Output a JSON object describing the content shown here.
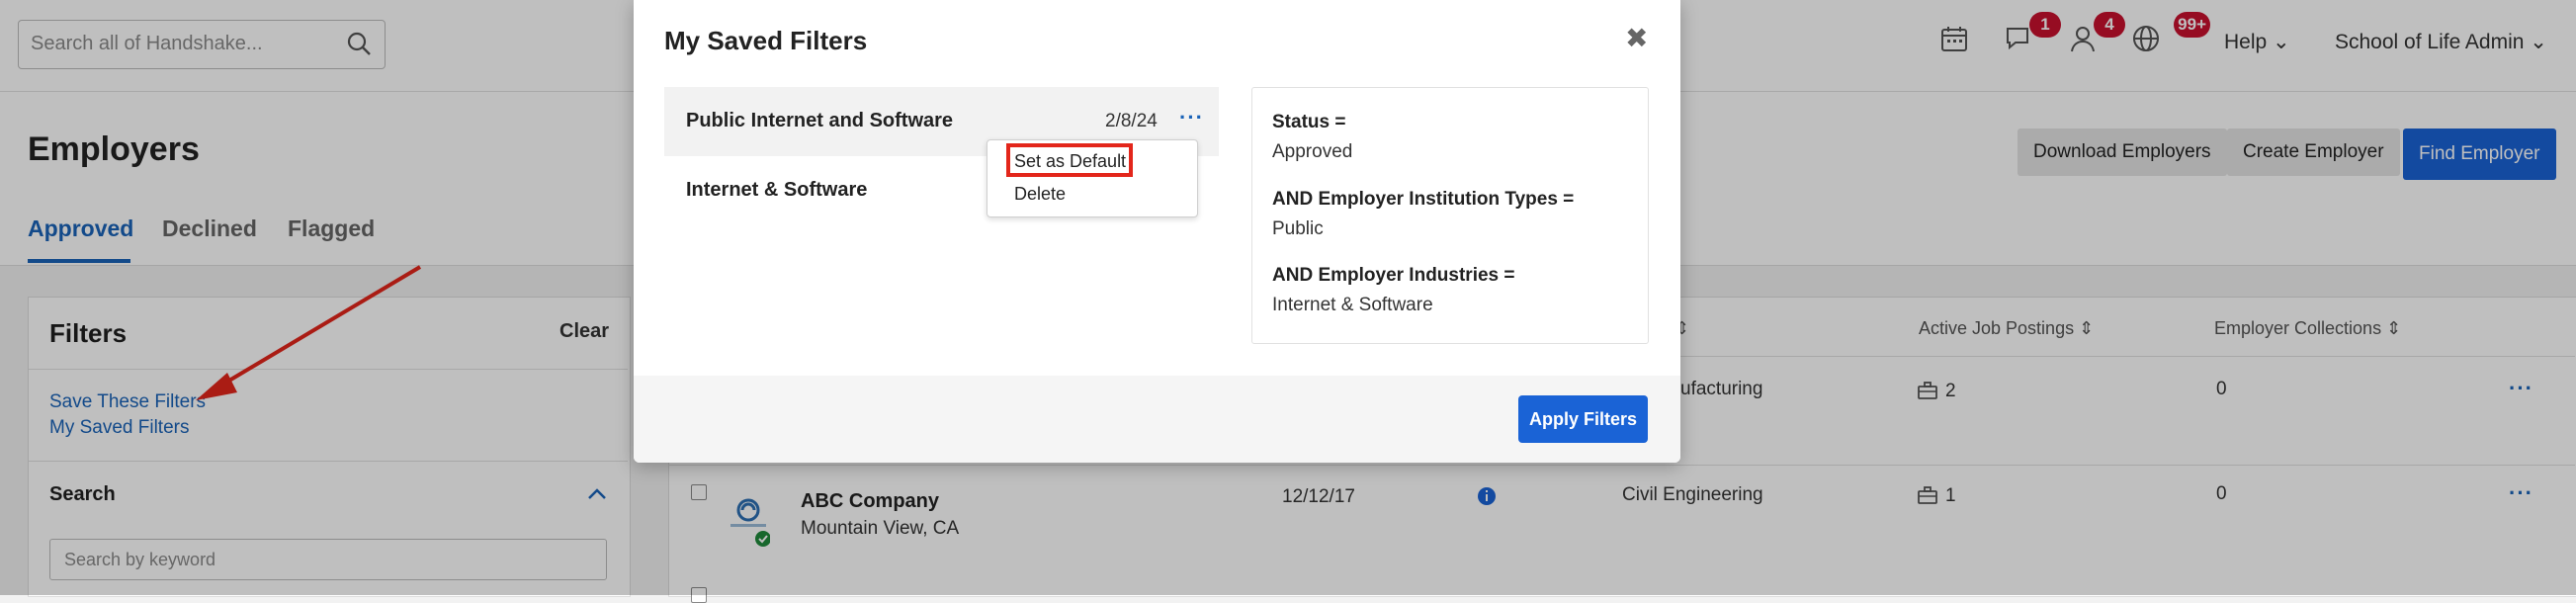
{
  "topnav": {
    "search_placeholder": "Search all of Handshake...",
    "messages_badge": "1",
    "people_badge": "4",
    "globe_badge": "99+",
    "help_label": "Help",
    "account_label": "School of Life Admin"
  },
  "page": {
    "title": "Employers",
    "tabs": [
      "Approved",
      "Declined",
      "Flagged"
    ],
    "active_tab": "Approved",
    "buttons": {
      "download": "Download Employers",
      "create": "Create Employer",
      "find": "Find Employer"
    }
  },
  "filters": {
    "title": "Filters",
    "clear": "Clear",
    "save_link": "Save These Filters",
    "saved_link": "My Saved Filters",
    "search_label": "Search",
    "keyword_placeholder": "Search by keyword"
  },
  "table": {
    "columns": {
      "industry": "y",
      "active_jobs": "Active Job Postings",
      "collections": "Employer Collections"
    },
    "rows": [
      {
        "industry": "ufacturing",
        "jobs": "2",
        "collections": "0"
      },
      {
        "name": "ABC Company",
        "location": "Mountain View, CA",
        "date": "12/12/17",
        "industry": "Civil Engineering",
        "jobs": "1",
        "collections": "0"
      }
    ]
  },
  "modal": {
    "title": "My Saved Filters",
    "close": "✖",
    "saved_filters": [
      {
        "name": "Public Internet and Software",
        "date": "2/8/24"
      },
      {
        "name": "Internet & Software",
        "date": ""
      }
    ],
    "menu_items": [
      "Set as Default",
      "Delete"
    ],
    "details": [
      {
        "label": "Status =",
        "value": "Approved"
      },
      {
        "label": "AND Employer Institution Types =",
        "value": "Public"
      },
      {
        "label": "AND Employer Industries =",
        "value": "Internet & Software"
      }
    ],
    "apply": "Apply Filters"
  },
  "colors": {
    "brand_blue": "#1a63d6",
    "link_blue": "#1a63b8",
    "annotation_red": "#e3261b",
    "badge_red": "#c8102e"
  }
}
